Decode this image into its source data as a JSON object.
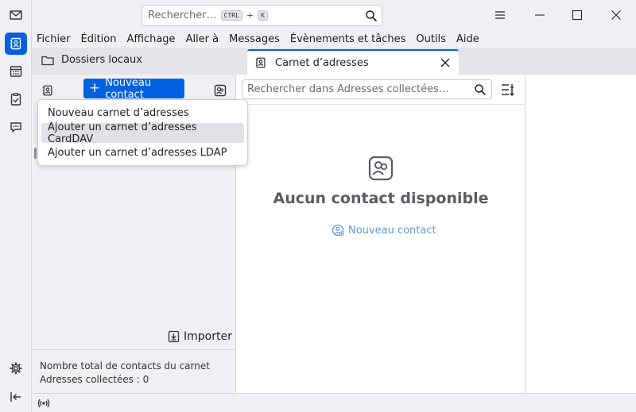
{
  "search": {
    "placeholder": "Rechercher…",
    "shortcut_key1": "CTRL",
    "shortcut_plus": "+",
    "shortcut_key2": "K"
  },
  "menubar": {
    "items": [
      "Fichier",
      "Édition",
      "Affichage",
      "Aller à",
      "Messages",
      "Évènements et tâches",
      "Outils",
      "Aide"
    ]
  },
  "tabs": {
    "folders_label": "Dossiers locaux",
    "addressbook_label": "Carnet d’adresses"
  },
  "books_pane": {
    "new_contact_label": "Nouveau contact",
    "import_label": "Importer",
    "footer_line1": "Nombre total de contacts du carnet",
    "footer_line2": "Adresses collectées : 0"
  },
  "dropdown": {
    "items": [
      "Nouveau carnet d’adresses",
      "Ajouter un carnet d’adresses CardDAV",
      "Ajouter un carnet d’adresses LDAP"
    ]
  },
  "list_pane": {
    "search_placeholder": "Rechercher dans Adresses collectées…",
    "empty_title": "Aucun contact disponible",
    "empty_link": "Nouveau contact"
  },
  "colors": {
    "accent": "#0061e0",
    "link": "#5a96dc",
    "background": "#f0f0f4"
  }
}
